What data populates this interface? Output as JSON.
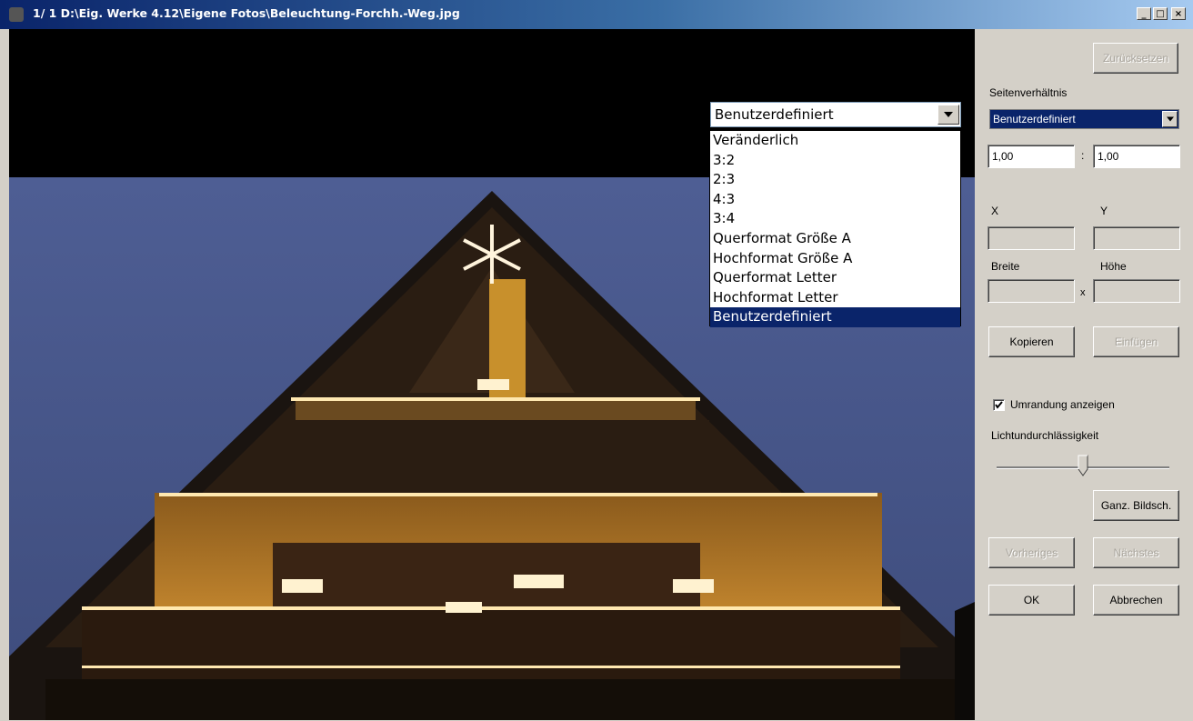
{
  "window": {
    "title": "1/  1  D:\\Eig. Werke 4.12\\Eigene Fotos\\Beleuchtung-Forchh.-Weg.jpg",
    "minimize_label": "_",
    "maximize_label": "□",
    "close_label": "×"
  },
  "dropdown": {
    "selected": "Benutzerdefiniert",
    "options": [
      "Veränderlich",
      "3:2",
      "2:3",
      "4:3",
      "3:4",
      "Querformat Größe A",
      "Hochformat Größe A",
      "Querformat Letter",
      "Hochformat Letter",
      "Benutzerdefiniert"
    ],
    "highlighted_index": 9
  },
  "sidebar": {
    "reset_button": "Zurücksetzen",
    "aspect_label": "Seitenverhältnis",
    "aspect_value": "Benutzerdefiniert",
    "ratio_width": "1,00",
    "ratio_separator": ":",
    "ratio_height": "1,00",
    "x_label": "X",
    "y_label": "Y",
    "width_label": "Breite",
    "height_label": "Höhe",
    "times_label": "x",
    "copy_button": "Kopieren",
    "paste_button": "Einfügen",
    "border_checkbox_label": "Umrandung anzeigen",
    "border_checked": true,
    "opacity_label": "Lichtundurchlässigkeit",
    "opacity_value": 0.5,
    "fullscreen_button": "Ganz. Bildsch.",
    "prev_button": "Vorheriges",
    "next_button": "Nächstes",
    "ok_button": "OK",
    "cancel_button": "Abbrechen"
  },
  "colors": {
    "titlebar_start": "#0a246a",
    "titlebar_end": "#a6caf0",
    "selection": "#0a246a",
    "panel": "#d4d0c8",
    "sky": "#4a5a8e",
    "lights": "#ffd98a"
  }
}
